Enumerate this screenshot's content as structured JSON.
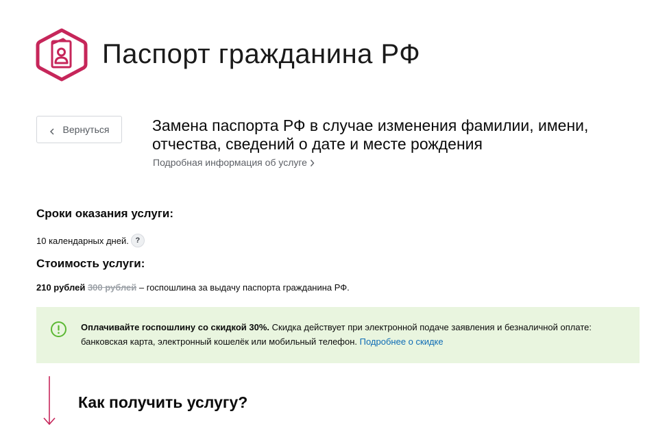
{
  "page": {
    "title": "Паспорт гражданина РФ",
    "icon": "passport-hexagon-icon",
    "accent_color": "#c6265a"
  },
  "back_button": {
    "label": "Вернуться",
    "icon": "chevron-left-icon"
  },
  "service": {
    "heading": "Замена паспорта РФ в случае изменения фамилии, имени, отчества, сведений о дате и месте рождения",
    "details_link": "Подробная информация об услуге",
    "details_icon": "chevron-right-icon"
  },
  "timing": {
    "title": "Сроки оказания услуги:",
    "value": "10 календарных дней.",
    "help_label": "?"
  },
  "cost": {
    "title": "Стоимость услуги:",
    "price_new": "210 рублей",
    "price_old": "300 рублей",
    "description": " – госпошлина за выдачу паспорта гражданина РФ."
  },
  "notice": {
    "icon": "exclamation-circle-icon",
    "icon_color": "#5bb833",
    "bold_text": "Оплачивайте госпошлину со скидкой 30%.",
    "text": " Скидка действует при электронной подаче заявления и безналичной оплате: банковская карта, электронный кошелёк или мобильный телефон. ",
    "link": "Подробнее о скидке",
    "link_color": "#0d6bb5",
    "background": "#e9f5df"
  },
  "how_to": {
    "title": "Как получить услугу?",
    "icon": "arrow-down-icon"
  }
}
